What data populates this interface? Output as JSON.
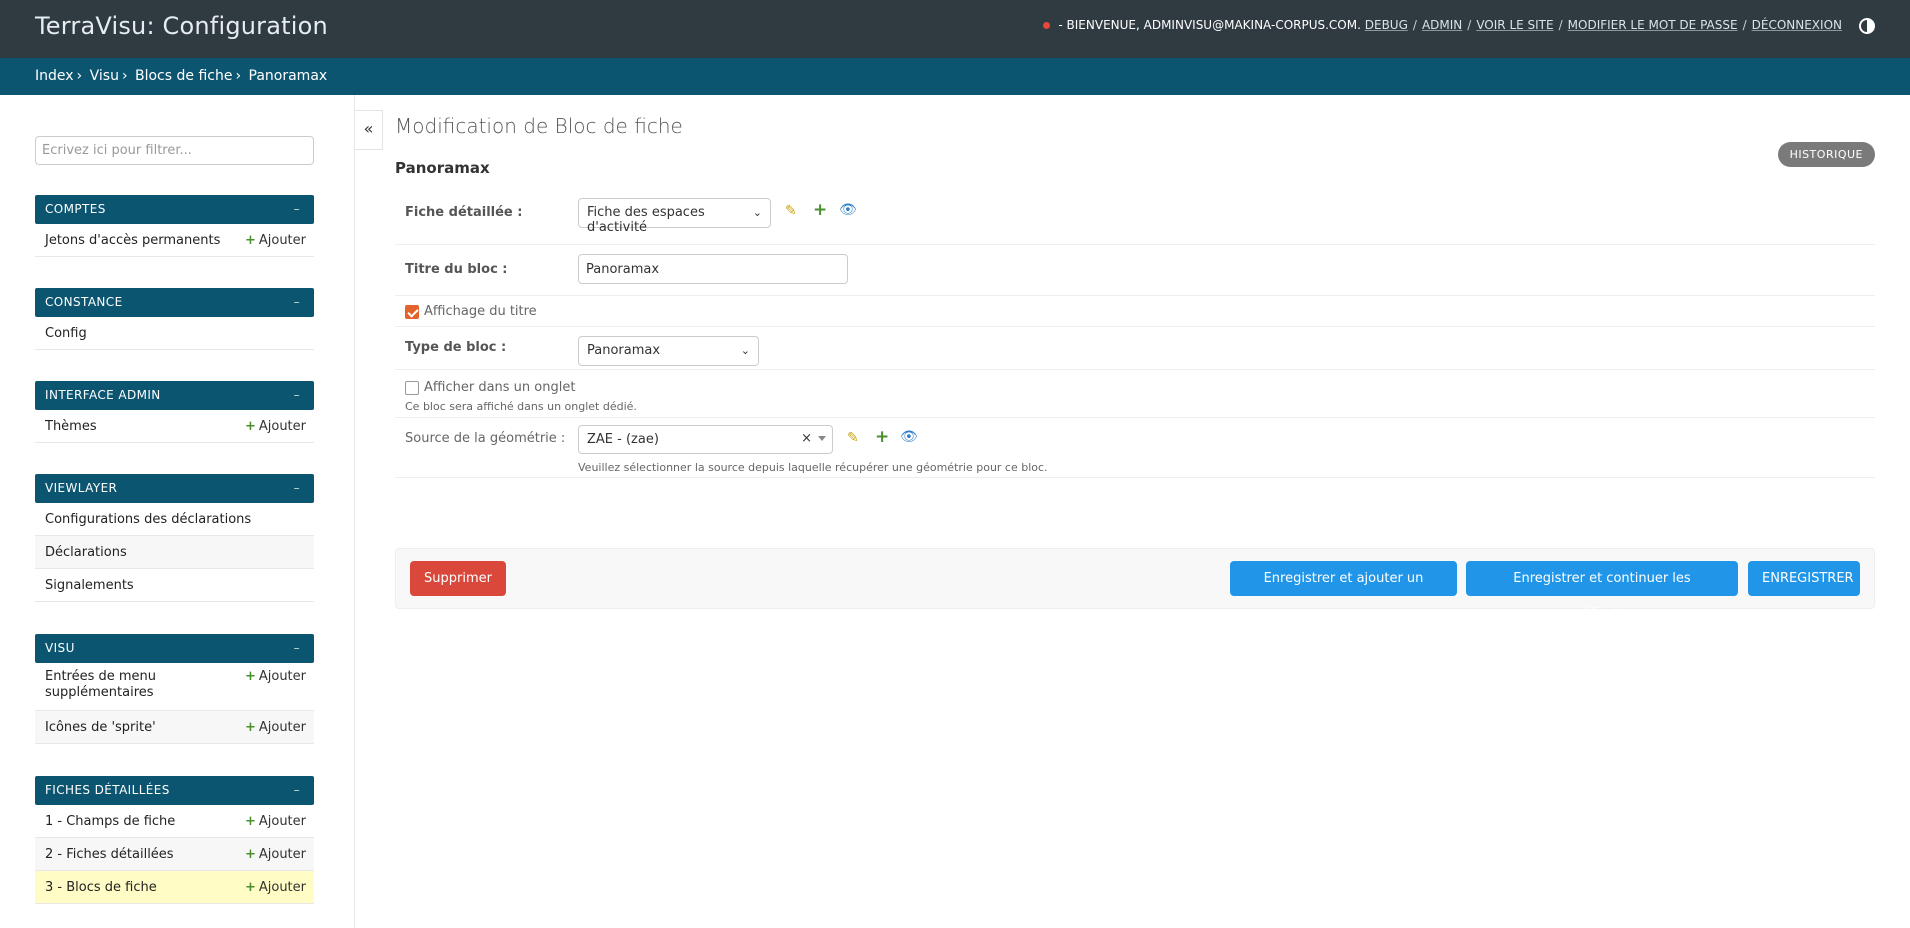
{
  "header": {
    "brand": "TerraVisu: Configuration",
    "welcome": "- BIENVENUE, ADMINVISU@MAKINA-CORPUS.COM.",
    "links": [
      "DEBUG",
      "ADMIN",
      "VOIR LE SITE",
      "MODIFIER LE MOT DE PASSE",
      "DÉCONNEXION"
    ],
    "status_dot_color": "#e8463a",
    "theme_icon": "contrast-icon"
  },
  "breadcrumbs": [
    "Index",
    "Visu",
    "Blocs de fiche",
    "Panoramax"
  ],
  "sidebar": {
    "filter_placeholder": "Écrivez ici pour filtrer...",
    "collapse_label": "«",
    "modules": [
      {
        "caption": "COMPTES",
        "toggle": "–",
        "rows": [
          {
            "label": "Jetons d'accès permanents",
            "add": "Ajouter"
          }
        ]
      },
      {
        "caption": "CONSTANCE",
        "toggle": "–",
        "rows": [
          {
            "label": "Config"
          }
        ]
      },
      {
        "caption": "INTERFACE ADMIN",
        "toggle": "–",
        "rows": [
          {
            "label": "Thèmes",
            "add": "Ajouter"
          }
        ]
      },
      {
        "caption": "VIEWLAYER",
        "toggle": "–",
        "rows": [
          {
            "label": "Configurations des déclarations"
          },
          {
            "label": "Déclarations"
          },
          {
            "label": "Signalements"
          }
        ]
      },
      {
        "caption": "VISU",
        "toggle": "–",
        "rows": [
          {
            "label": "Entrées de menu supplémentaires",
            "add": "Ajouter"
          },
          {
            "label": "Icônes de 'sprite'",
            "add": "Ajouter"
          }
        ]
      },
      {
        "caption": "FICHES DÉTAILLÉES",
        "toggle": "–",
        "rows": [
          {
            "label": "1 - Champs de fiche",
            "add": "Ajouter"
          },
          {
            "label": "2 - Fiches détaillées",
            "add": "Ajouter"
          },
          {
            "label": "3 - Blocs de fiche",
            "add": "Ajouter"
          }
        ]
      }
    ]
  },
  "main": {
    "title": "Modification de Bloc de fiche",
    "history": "HISTORIQUE",
    "object_name": "Panoramax",
    "fields": {
      "fiche": {
        "label": "Fiche détaillée :",
        "value": "Fiche des espaces d'activité"
      },
      "titre": {
        "label": "Titre du bloc :",
        "value": "Panoramax"
      },
      "affichage": {
        "label": "Affichage du titre",
        "checked": true
      },
      "type": {
        "label": "Type de bloc :",
        "value": "Panoramax"
      },
      "onglet": {
        "label": "Afficher dans un onglet",
        "checked": false,
        "help": "Ce bloc sera affiché dans un onglet dédié."
      },
      "source": {
        "label": "Source de la géométrie :",
        "value": "ZAE - (zae)",
        "clear": "×",
        "help": "Veuillez sélectionner la source depuis laquelle récupérer une géométrie pour ce bloc."
      }
    },
    "actions": {
      "delete": "Supprimer",
      "save_add": "Enregistrer et ajouter un nouveau",
      "save_continue": "Enregistrer et continuer les modifications",
      "save": "ENREGISTRER"
    }
  }
}
